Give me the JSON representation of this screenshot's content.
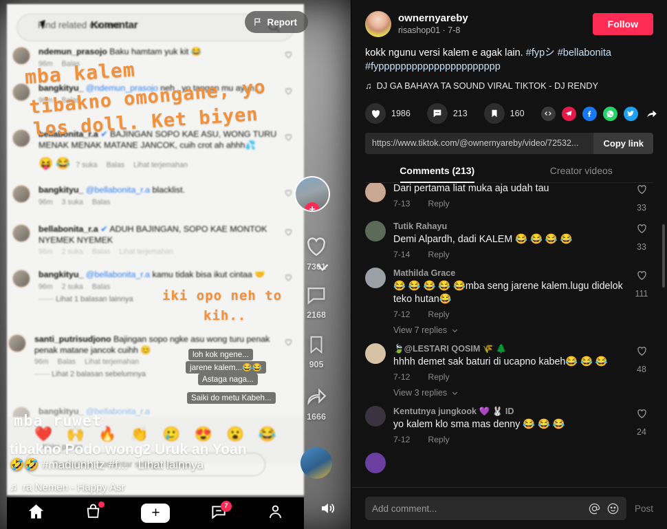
{
  "video_panel": {
    "ig_overlay": {
      "find_related_label": "Find related content",
      "header_title": "Komentar",
      "comments": [
        {
          "user": "ndemun_prasojo",
          "text": " Baku hamtam yuk kit 😂",
          "meta": [
            "96m",
            "Balas"
          ]
        },
        {
          "user": "bangkityu_",
          "mention": " @ndemun_prasojo",
          "text": " neh , yo tangan mu ayun...",
          "meta": [
            "96m",
            "Balas"
          ]
        },
        {
          "user": "bellabonita_r.a",
          "verified": true,
          "text": " BAJINGAN SOPO KAE ASU, WONG TURU MENAK MENAK MATANE JANCOK, cuih crot ah ahhh💦",
          "meta": [
            "7 suka",
            "Balas",
            "Lihat terjemahan"
          ]
        },
        {
          "user": "bangkityu_",
          "mention": " @bellabonita_r.a",
          "text": " blacklist.",
          "meta": [
            "96m",
            "3 suka",
            "Balas"
          ]
        },
        {
          "user": "bellabonita_r.a",
          "verified": true,
          "text": " ADUH BAJINGAN, SOPO KAE MONTOK NYEMEK NYEMEK",
          "meta": [
            "96m",
            "2 suka",
            "Balas",
            "Lihat terjemahan"
          ]
        },
        {
          "user": "bangkityu_",
          "mention": " @bellabonita_r.a",
          "text": " kamu tidak bisa ikut cintaa 🤝",
          "meta": [
            "96m",
            "2 suka",
            "Balas"
          ],
          "sub": "Lihat 1 balasan lainnya"
        },
        {
          "user": "santi_putrisudjono",
          "text": " Bajingan sopo ngke asu wong turu penak penak matane jancok cuihh 😊",
          "meta": [
            "96m",
            "Balas",
            "Lihat terjemahan"
          ],
          "sub": "Lihat 2 balasan sebelumnya"
        },
        {
          "user": "bangkityu_",
          "mention": " @bellabonita_r.a",
          "text": "",
          "meta": []
        }
      ],
      "emoji_row": [
        "❤️",
        "🙌",
        "🔥",
        "👏",
        "🥲",
        "😍",
        "😮",
        "😂"
      ],
      "send_message_placeholder": "Tambahkan komentar sebagai bmtaw..."
    },
    "handwriting": [
      "mba kalem",
      "tibakno omongane, yo",
      "los doll. Ket biyen",
      "iki opo neh to",
      "kih..",
      "mba ruwet",
      "tibakno Podo wong2 Uruk an Yoan"
    ],
    "chips": [
      "loh kok ngene...",
      "jarene kalem...😂😂",
      "Astaga naga...",
      "Saiki do metu Kabeh..."
    ],
    "rail_counts": [
      "7301",
      "2168",
      "905",
      "1666"
    ],
    "tiktok_caption": {
      "emojis": "🤣🤣",
      "hashtags": "#madiunhitz #f...",
      "more": "Lihat lainnya",
      "music": "ra    Nemen - Happy Asr"
    },
    "report_label": "Report",
    "nav": {
      "home": "home-icon",
      "shop": "shop-icon",
      "create": "+",
      "inbox_badge": "7",
      "profile": "profile-icon"
    }
  },
  "detail": {
    "author": {
      "name": "ownernyareby",
      "handle_and_date": "risashop01 · 7-8",
      "follow_label": "Follow"
    },
    "caption_text": "kokk ngunu versi kalem e agak lain. ",
    "caption_tags": [
      "#fypシ",
      "#bellabonita",
      "#fypppppppppppppppppppppp"
    ],
    "music_label": "DJ GA BAHAYA TA SOUND VIRAL TIKTOK - DJ RENDY",
    "actions": {
      "likes": "1986",
      "comments": "213",
      "saves": "160"
    },
    "share_icons": [
      "embed-icon",
      "telegram-icon",
      "facebook-icon",
      "whatsapp-icon",
      "twitter-icon",
      "share-arrow-icon"
    ],
    "link": {
      "url": "https://www.tiktok.com/@ownernyareby/video/72532...",
      "copy_label": "Copy link"
    },
    "tabs": [
      {
        "label": "Comments (213)",
        "active": true
      },
      {
        "label": "Creator videos",
        "active": false
      }
    ],
    "comments": [
      {
        "name": "",
        "text": "Dari pertama liat muka aja udah tau",
        "date": "7-13",
        "reply": "Reply",
        "likes": "33",
        "avatar_color": "#caa894",
        "partial": true
      },
      {
        "name": "Tutik Rahayu",
        "text": "Demi Alpardh, dadi KALEM 😂 😂 😂 😂",
        "date": "7-14",
        "reply": "Reply",
        "likes": "33",
        "avatar_color": "#5c6b57"
      },
      {
        "name": "Mathilda Grace",
        "text": "😂 😂 😂 😂 😂mba seng jarene kalem.lugu didelok teko hutan😂",
        "date": "7-12",
        "reply": "Reply",
        "likes": "111",
        "avatar_color": "#9aa0a6",
        "replies_label": "View 7 replies"
      },
      {
        "name": "🍃@LESTARI QOSIM 🌾 🌲",
        "text": "hhhh demet sak baturi di ucapno kabeh😂 😂 😂",
        "date": "7-12",
        "reply": "Reply",
        "likes": "48",
        "avatar_color": "#d6c2a4",
        "replies_label": "View 3 replies"
      },
      {
        "name": "Kentutnya jungkook 💜 🐰 ID",
        "text": "yo kalem klo sma mas denny 😂 😂 😂",
        "date": "7-12",
        "reply": "Reply",
        "likes": "24",
        "avatar_color": "#3b3340"
      }
    ],
    "composer": {
      "placeholder": "Add comment...",
      "mention_icon": "at-icon",
      "emoji_icon": "emoji-icon",
      "post_label": "Post"
    }
  },
  "colors": {
    "brand_red": "#fe2c55",
    "brand_cyan": "#25f4ee",
    "panel_bg": "#121212",
    "handwriting_orange": "#f2913c"
  }
}
